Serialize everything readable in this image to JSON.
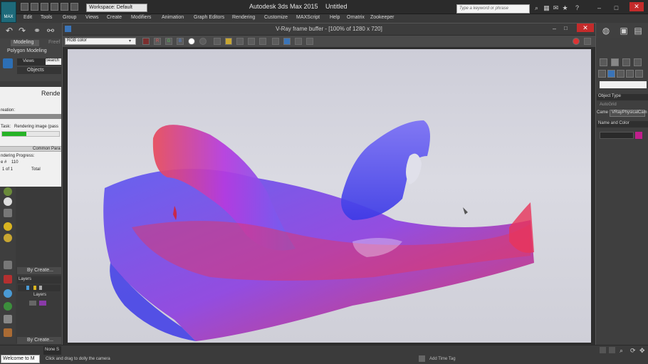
{
  "app": {
    "title": "Autodesk 3ds Max  2015",
    "document": "Untitled",
    "workspace": "Workspace: Default",
    "search_placeholder": "Type a keyword or phrase",
    "logo_text": "MAX"
  },
  "menu": [
    "Edit",
    "Tools",
    "Group",
    "Views",
    "Create",
    "Modifiers",
    "Animation",
    "Graph Editors",
    "Rendering",
    "Customize",
    "MAXScript",
    "Help",
    "Ornatrix",
    "Zookeeper"
  ],
  "ribbon": {
    "tab_modeling": "Modeling",
    "tab_freeform": "Freef",
    "polygon_modeling": "Polygon Modeling"
  },
  "scene_explorer": {
    "views_label": "Views",
    "search_label": "Search",
    "objects_label": "Objects"
  },
  "render_dialog": {
    "title": "Rende",
    "creation_label": "reation:",
    "task_label": "Task:",
    "task_value": "Rendering image (pass",
    "progress": 0.42,
    "common_params": "Common Para",
    "rendering_progress": "ndering Progress:",
    "frame_label": "e #",
    "frame_value": "110",
    "frame_count": "1 of 1",
    "total_label": "Total"
  },
  "left_panel": {
    "by_create_1": "By Create...",
    "layers_header": "Layers",
    "layers_label": "Layers",
    "by_create_2": "By Create..."
  },
  "vfb": {
    "title": "V-Ray frame buffer - [100% of 1280 x 720]",
    "channel": "RGB color",
    "buttons": [
      "R",
      "G",
      "B"
    ]
  },
  "right_panel": {
    "object_type": "Object Type",
    "autogrid": "AutoGrid",
    "camera_label": "Came",
    "camera_value": "VRayPhysicalCam",
    "name_color": "Name and Color",
    "swatch_color": "#c01f8c"
  },
  "statusbar": {
    "welcome": "Welcome to M",
    "none_label": "None S",
    "prompt": "Click and drag to dolly the camera",
    "add_time_tag": "Add Time Tag"
  }
}
